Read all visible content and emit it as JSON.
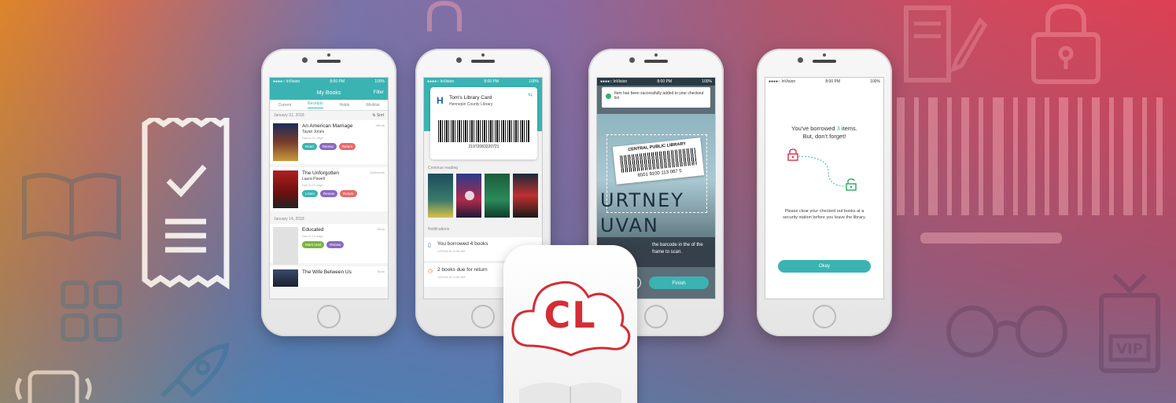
{
  "colors": {
    "teal": "#3bb3b3",
    "red": "#e23c4e",
    "green": "#35b06a",
    "purple": "#8a6ac0",
    "brand_red": "#d42d35"
  },
  "background_icons": [
    "open-book-icon",
    "receipt-check-icon",
    "grid-icon",
    "rocket-icon",
    "phone-wave-icon",
    "lock-icon",
    "padlock-icon",
    "document-edit-icon",
    "barcode-icon",
    "glasses-icon",
    "vip-badge-icon"
  ],
  "phone1": {
    "status_carrier": "●●●●○ InVision",
    "status_time": "8:00 PM",
    "status_battery": "100%",
    "title": "My Books",
    "filter": "Filter",
    "tabs": [
      "Current",
      "Receipts",
      "Holds",
      "Wishlist"
    ],
    "active_tab": "Receipts",
    "date1": "January 31, 2018",
    "sort": "⇅ Sort",
    "books": [
      {
        "title": "An American Marriage",
        "author": "Tayari Jones",
        "due": "Due in 21 days",
        "status": "eBook",
        "buttons": [
          "Read",
          "Renew",
          "Return"
        ]
      },
      {
        "title": "The Unforgotten",
        "author": "Laura Powell",
        "due": "Due in 21 days",
        "status": "Audiobook",
        "buttons": [
          "Listen",
          "Renew",
          "Return"
        ]
      }
    ],
    "date2": "January 14, 2018",
    "book3": {
      "title": "Educated",
      "due": "Due in 14 days",
      "status": "Book",
      "buttons": [
        "Mark read",
        "Renew"
      ]
    },
    "book4": {
      "title": "The Wife Between Us",
      "status": "Book"
    }
  },
  "phone2": {
    "status_carrier": "●●●●○ InVision",
    "status_time": "8:00 PM",
    "status_battery": "100%",
    "card_title": "Tom's Library Card",
    "card_sub": "Hennepin County Library",
    "card_number": "21972083220721",
    "continue_label": "Continue reading",
    "notifications_label": "Notifications",
    "notif1": {
      "text": "You borrowed 4 books",
      "date": "1/29/18 at 11:58 AM"
    },
    "notif2": {
      "text": "2 books due for return",
      "date": "1/29/18 at 11:58 AM"
    }
  },
  "phone3": {
    "status_carrier": "●●●●○ InVision",
    "status_time": "8:00 PM",
    "status_battery": "100%",
    "toast": "Item has been successfully added to your checkout list",
    "label_title": "CENTRAL PUBLIC LIBRARY",
    "label_number": "8501 9100 113 087 5",
    "book_line1": "URTNEY",
    "book_line2": "UVAN",
    "help": "the barcode in the of the frame to scan.",
    "finish": "Finish"
  },
  "phone4": {
    "status_carrier": "●●●●○ InVision",
    "status_time": "8:00 PM",
    "status_battery": "100%",
    "msg_pre": "You've borrowed",
    "msg_num": "3",
    "msg_post": "items.",
    "msg_line2": "But, don't forget!",
    "note": "Please clear your checked out books at a security station before you leave the library.",
    "okay": "Okay"
  },
  "app_icon": {
    "text": "CL"
  }
}
